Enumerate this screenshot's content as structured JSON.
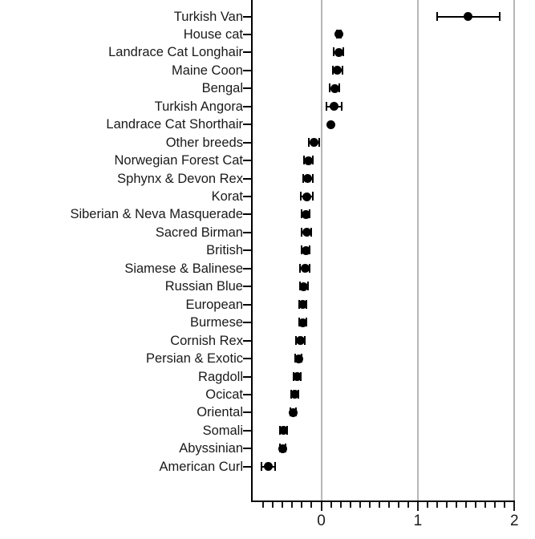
{
  "chart_data": {
    "type": "scatter",
    "title": "",
    "subtitle": "",
    "xlabel": "",
    "ylabel": "",
    "orientation": "horizontal",
    "grid": "vertical-major-only",
    "legend": null,
    "xlim": [
      -0.66,
      2.0
    ],
    "xticks": [
      0,
      1,
      2
    ],
    "xticklabels": [
      "0",
      "1",
      "2"
    ],
    "xminor_step": 0.1,
    "marker": "filled-circle",
    "error_bars": "horizontal-caps",
    "categories": [
      "Turkish Van",
      "House cat",
      "Landrace Cat Longhair",
      "Maine Coon",
      "Bengal",
      "Turkish Angora",
      "Landrace Cat Shorthair",
      "Other breeds",
      "Norwegian Forest Cat",
      "Sphynx & Devon Rex",
      "Korat",
      "Siberian & Neva Masquerade",
      "Sacred Birman",
      "British",
      "Siamese & Balinese",
      "Russian Blue",
      "European",
      "Burmese",
      "Cornish Rex",
      "Persian & Exotic",
      "Ragdoll",
      "Ocicat",
      "Oriental",
      "Somali",
      "Abyssinian",
      "American Curl"
    ],
    "points": [
      {
        "label": "Turkish Van",
        "value": 1.52,
        "low": 1.2,
        "high": 1.85
      },
      {
        "label": "House cat",
        "value": 0.18,
        "low": 0.16,
        "high": 0.2
      },
      {
        "label": "Landrace Cat Longhair",
        "value": 0.18,
        "low": 0.13,
        "high": 0.23
      },
      {
        "label": "Maine Coon",
        "value": 0.17,
        "low": 0.12,
        "high": 0.22
      },
      {
        "label": "Bengal",
        "value": 0.14,
        "low": 0.09,
        "high": 0.19
      },
      {
        "label": "Turkish Angora",
        "value": 0.13,
        "low": 0.05,
        "high": 0.21
      },
      {
        "label": "Landrace Cat Shorthair",
        "value": 0.1,
        "low": 0.1,
        "high": 0.1
      },
      {
        "label": "Other breeds",
        "value": -0.075,
        "low": -0.13,
        "high": -0.02
      },
      {
        "label": "Norwegian Forest Cat",
        "value": -0.13,
        "low": -0.175,
        "high": -0.085
      },
      {
        "label": "Sphynx & Devon Rex",
        "value": -0.14,
        "low": -0.19,
        "high": -0.09
      },
      {
        "label": "Korat",
        "value": -0.15,
        "low": -0.21,
        "high": -0.09
      },
      {
        "label": "Siberian & Neva Masquerade",
        "value": -0.16,
        "low": -0.2,
        "high": -0.12
      },
      {
        "label": "Sacred Birman",
        "value": -0.15,
        "low": -0.2,
        "high": -0.1
      },
      {
        "label": "British",
        "value": -0.16,
        "low": -0.2,
        "high": -0.12
      },
      {
        "label": "Siamese & Balinese",
        "value": -0.17,
        "low": -0.22,
        "high": -0.12
      },
      {
        "label": "Russian Blue",
        "value": -0.18,
        "low": -0.22,
        "high": -0.14
      },
      {
        "label": "European",
        "value": -0.19,
        "low": -0.23,
        "high": -0.15
      },
      {
        "label": "Burmese",
        "value": -0.19,
        "low": -0.23,
        "high": -0.15
      },
      {
        "label": "Cornish Rex",
        "value": -0.215,
        "low": -0.26,
        "high": -0.17
      },
      {
        "label": "Persian & Exotic",
        "value": -0.235,
        "low": -0.27,
        "high": -0.2
      },
      {
        "label": "Ragdoll",
        "value": -0.25,
        "low": -0.29,
        "high": -0.21
      },
      {
        "label": "Ocicat",
        "value": -0.275,
        "low": -0.31,
        "high": -0.24
      },
      {
        "label": "Oriental",
        "value": -0.29,
        "low": -0.32,
        "high": -0.26
      },
      {
        "label": "Somali",
        "value": -0.39,
        "low": -0.43,
        "high": -0.35
      },
      {
        "label": "Abyssinian",
        "value": -0.4,
        "low": -0.43,
        "high": -0.37
      },
      {
        "label": "American Curl",
        "value": -0.55,
        "low": -0.62,
        "high": -0.48
      }
    ],
    "colors": {
      "marker": "#000000",
      "error_bar": "#000000",
      "gridline": "#b6b6b6",
      "axis": "#000000",
      "text": "#1a1a1a",
      "background": "#ffffff"
    }
  }
}
